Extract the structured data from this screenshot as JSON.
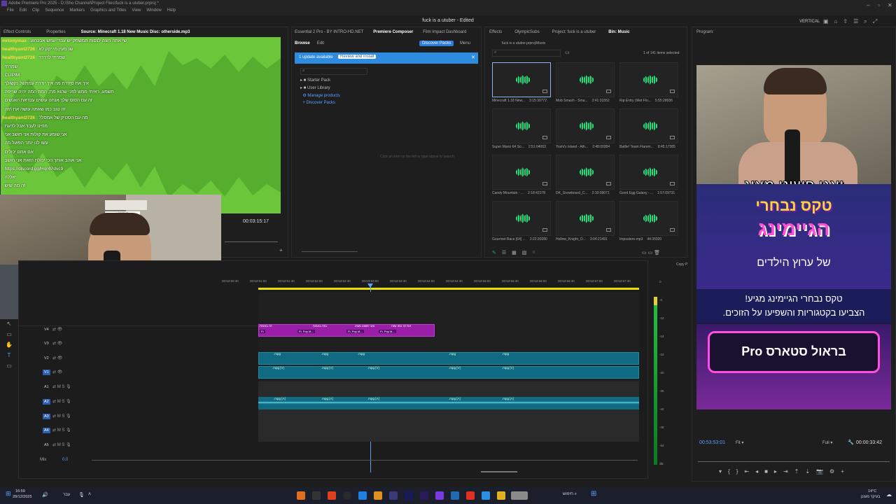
{
  "titlebar": {
    "app_line": "Adobe Premiere Pro 2025 - D:\\Sho Channel\\Project Files\\fuck is a utuber.prproj *",
    "menus": [
      "File",
      "Edit",
      "Clip",
      "Sequence",
      "Markers",
      "Graphics and Titles",
      "View",
      "Window",
      "Help"
    ],
    "workspace_label": "VERTICAL",
    "window_title": "fuck is a utuber - Edited"
  },
  "source_panel": {
    "tabs": [
      "Effect Controls",
      "Properties",
      "Source: Minecraft 1.18 New Music Disc: otherside.mp3"
    ],
    "timecode": "00:03:15:17"
  },
  "chat_overlay": {
    "lines": [
      {
        "user": "mrtonymax",
        "text": "שי אתה רוצה לנסות תמשחק יש עבדי עחש אבכרגע"
      },
      {
        "user": "healthyant2726",
        "text": "שנ מעין מי יקק לא"
      },
      {
        "user": "healthyant2726",
        "text": "שמרתי לרררר"
      },
      {
        "user": "",
        "text": "שמרתי"
      },
      {
        "user": "",
        "text": "CLIPIM"
      },
      {
        "user": "",
        "text": "איך את סידרת מה איך יודרת עמתשל נקשולך"
      },
      {
        "user": "",
        "text": "תשמע, ראיתי ממש לפני שהוא מת, המת המה יהיה שריפה"
      },
      {
        "user": "",
        "text": "זה עם הסוס שלך אנחנו עושים עבדאת האנשים"
      },
      {
        "user": "",
        "text": "זה טוב כמו שאתה עושה את הזה"
      },
      {
        "user": "healthyant2726",
        "text": "מה עם הסטיק של אמסל?"
      },
      {
        "user": "",
        "text": "מחינו לעבד אבל לדעת"
      },
      {
        "user": "",
        "text": "אני שומע את קולות אני חושב אני"
      },
      {
        "user": "",
        "text": "עשו לנו יותר הפועל מה"
      },
      {
        "user": "",
        "text": "אם אתם יכולים"
      },
      {
        "user": "",
        "text": "אני אוהב אותך הכי יכולת הזאת אני חושב"
      },
      {
        "user": "",
        "text": "https://discord.gg/Hqr4Pdvc9"
      },
      {
        "user": "",
        "text": "יאללה"
      },
      {
        "user": "",
        "text": "זה מה שיש"
      }
    ]
  },
  "composer_panel": {
    "tabs": [
      "Essential 2 Pro - BY INTRO-HD.NET",
      "Premiere Composer",
      "Film Impact Dashboard"
    ],
    "subtabs": [
      "Browse",
      "Edit"
    ],
    "discover_button": "Discover Packs",
    "menu_button": "Menu",
    "update_text": "1 update available",
    "review_button": "Review and install",
    "tree": [
      "Starter Pack",
      "User Library",
      "Manage products",
      "Discover Packs"
    ],
    "empty_hint": "Click an item on the left or type above to search"
  },
  "project_panel": {
    "tabs": [
      "Effects",
      "OlympicSubs",
      "Project: fuck is a utuber",
      "Bin: Music"
    ],
    "path": "fuck is a utuber.prproj\\Music",
    "count": "1 of 141 items selected",
    "items": [
      {
        "name": "Minecraft 1.18 New...",
        "dur": "3:15:30772",
        "selected": true
      },
      {
        "name": "Mob Smash - Sma...",
        "dur": "2:41:31552",
        "selected": false
      },
      {
        "name": "Rip Entry (Wet Flo...",
        "dur": "5:55:28036",
        "selected": false
      },
      {
        "name": "Super Mario 64 So...",
        "dur": "2:51:04063",
        "selected": false
      },
      {
        "name": "Yoshi's Island - Ath...",
        "dur": "2:48:00384",
        "selected": false
      },
      {
        "name": "Battle! Team Flarem...",
        "dur": "8:45:17385",
        "selected": false
      },
      {
        "name": "Candy Mountain - ...",
        "dur": "2:18:42278",
        "selected": false
      },
      {
        "name": "DK_Snowboard_C...",
        "dur": "2:10:09071",
        "selected": false
      },
      {
        "name": "Good Egg Galaxy - ...",
        "dur": "1:57:09731",
        "selected": false
      },
      {
        "name": "Gourmet Race [64] ...",
        "dur": "2:22:30280",
        "selected": false
      },
      {
        "name": "Hollow_Knight_O...",
        "dur": "3:04:21491",
        "selected": false
      },
      {
        "name": "Impostere.mp3",
        "dur": "44:35920",
        "selected": false
      }
    ]
  },
  "program_panel": {
    "tab": "Program:",
    "overlay_line1": "ואני פשוט מציג",
    "logo_line1": "טקס נבחרי",
    "logo_line2": "הגיימינג",
    "logo_line3": "של ערוץ הילדים",
    "notice_line1": "טקס נבחרי הגיימינג מגיע!",
    "notice_line2": "הצביעו בקטגוריות והשפיעו על הזוכים.",
    "card_label": "בראול סטארס Pro",
    "timecode": "00:53:53:01",
    "fit": "Fit",
    "full": "Full",
    "duration": "00:00:33:42"
  },
  "timeline": {
    "ruler": [
      "00:53:50:30",
      "00:53:51:00",
      "00:53:51:30",
      "00:53:52:00",
      "00:53:52:30",
      "00:53:53:00",
      "00:53:53:30",
      "00:53:54:00",
      "00:53:54:30",
      "00:53:55:00",
      "00:53:55:30",
      "00:53:56:00",
      "00:53:56:30",
      "00:53:57:00",
      "00:53:57:30"
    ],
    "video_tracks": [
      "V4",
      "V3",
      "V2",
      "V1"
    ],
    "audio_tracks": [
      "A1",
      "A2",
      "A3",
      "A4",
      "A5"
    ],
    "mix_label": "Mix",
    "mix_value": "0.0",
    "graphic_clips": [
      "Ft. Pop M...",
      "Ft. Pop M...",
      "Ft. Pop M..."
    ],
    "graphic_titles": [
      "זה באמת",
      "בזה באמת",
      "ואני פשוט מציג",
      "את זה כמו שזה"
    ],
    "video_clip_label": ".mpg",
    "video_clip_label_v": ".mpg [V]",
    "audio_clip_label": ".mpg [A]",
    "meter_labels": [
      "0",
      "-6",
      "-12",
      "-18",
      "-24",
      "-30",
      "-36",
      "-42",
      "-48",
      "-54",
      "dB"
    ],
    "copy_label": "Copy P"
  },
  "taskbar": {
    "time": "16:59",
    "date": "28/12/2025",
    "lang": "עבר",
    "search": "חיפוש",
    "weather": "14°C",
    "weather_text": "בעיקר מעונן"
  },
  "colors": {
    "accent": "#2d7cd9",
    "clip_video": "#0f6a82",
    "clip_graphic": "#9b1ea8",
    "waveform_bg": "#6cc63a",
    "meter": "#20c040"
  }
}
